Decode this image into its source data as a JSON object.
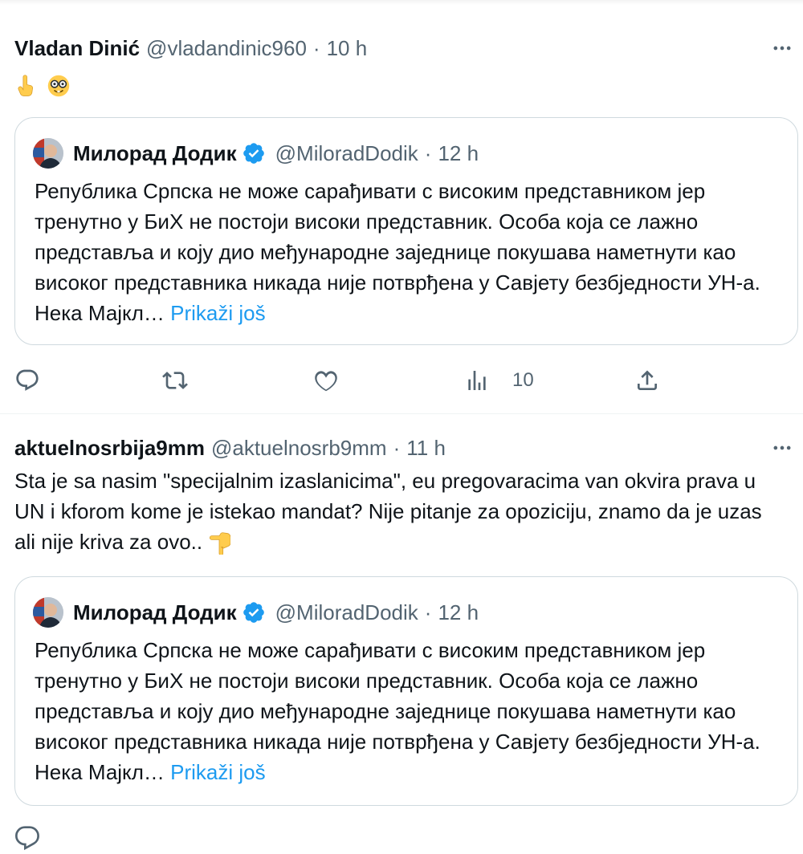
{
  "tweets": [
    {
      "author_name": "Vladan Dinić",
      "author_handle": "@vladandinic960",
      "dot": "·",
      "time": "10 h",
      "text_emoji": [
        "pointing-up-emoji",
        "nerd-face-emoji"
      ],
      "quote": {
        "author_name": "Милорад Додик",
        "author_handle": "@MiloradDodik",
        "dot": "·",
        "time": "12 h",
        "text": "Република Српска не може сарађивати с високим представником јер тренутно у БиХ не постоји високи представник. Особа која се лажно представља и коју дио међународне заједнице покушава наметнути као високог представника никада није потврђена у Савјету безбједности УН-а. Нека Мајкл…",
        "show_more": "Prikaži još"
      },
      "actions": {
        "views": "10"
      }
    },
    {
      "author_name": "aktuelnosrbija9mm",
      "author_handle": "@aktuelnosrb9mm",
      "dot": "·",
      "time": "11 h",
      "text": "Sta je sa nasim \"specijalnim izaslanicima\", eu pregovaracima van okvira prava u UN i kforom kome je istekao mandat? Nije pitanje za opoziciju, znamo da je uzas ali nije kriva za ovo..",
      "text_emoji": [
        "pointing-down-emoji"
      ],
      "quote": {
        "author_name": "Милорад Додик",
        "author_handle": "@MiloradDodik",
        "dot": "·",
        "time": "12 h",
        "text": "Република Српска не може сарађивати с високим представником јер тренутно у БиХ не постоји високи представник. Особа која се лажно представља и коју дио међународне заједнице покушава наметнути као високог представника никада није потврђена у Савјету безбједности УН-а. Нека Мајкл…",
        "show_more": "Prikaži još"
      }
    }
  ],
  "colors": {
    "text": "#0f1419",
    "secondary": "#536471",
    "link": "#1d9bf0",
    "border": "#cfd9de",
    "verified": "#1d9bf0"
  }
}
